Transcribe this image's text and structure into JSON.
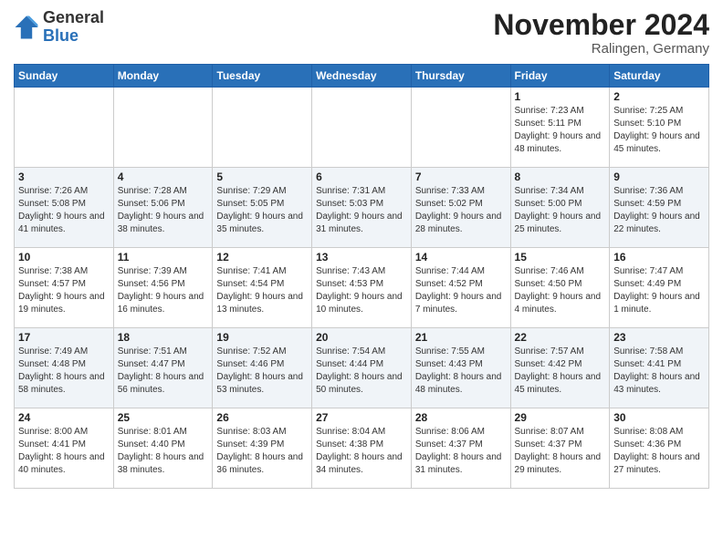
{
  "logo": {
    "general": "General",
    "blue": "Blue"
  },
  "title": "November 2024",
  "location": "Ralingen, Germany",
  "days_of_week": [
    "Sunday",
    "Monday",
    "Tuesday",
    "Wednesday",
    "Thursday",
    "Friday",
    "Saturday"
  ],
  "weeks": [
    [
      {
        "day": "",
        "info": ""
      },
      {
        "day": "",
        "info": ""
      },
      {
        "day": "",
        "info": ""
      },
      {
        "day": "",
        "info": ""
      },
      {
        "day": "",
        "info": ""
      },
      {
        "day": "1",
        "info": "Sunrise: 7:23 AM\nSunset: 5:11 PM\nDaylight: 9 hours and 48 minutes."
      },
      {
        "day": "2",
        "info": "Sunrise: 7:25 AM\nSunset: 5:10 PM\nDaylight: 9 hours and 45 minutes."
      }
    ],
    [
      {
        "day": "3",
        "info": "Sunrise: 7:26 AM\nSunset: 5:08 PM\nDaylight: 9 hours and 41 minutes."
      },
      {
        "day": "4",
        "info": "Sunrise: 7:28 AM\nSunset: 5:06 PM\nDaylight: 9 hours and 38 minutes."
      },
      {
        "day": "5",
        "info": "Sunrise: 7:29 AM\nSunset: 5:05 PM\nDaylight: 9 hours and 35 minutes."
      },
      {
        "day": "6",
        "info": "Sunrise: 7:31 AM\nSunset: 5:03 PM\nDaylight: 9 hours and 31 minutes."
      },
      {
        "day": "7",
        "info": "Sunrise: 7:33 AM\nSunset: 5:02 PM\nDaylight: 9 hours and 28 minutes."
      },
      {
        "day": "8",
        "info": "Sunrise: 7:34 AM\nSunset: 5:00 PM\nDaylight: 9 hours and 25 minutes."
      },
      {
        "day": "9",
        "info": "Sunrise: 7:36 AM\nSunset: 4:59 PM\nDaylight: 9 hours and 22 minutes."
      }
    ],
    [
      {
        "day": "10",
        "info": "Sunrise: 7:38 AM\nSunset: 4:57 PM\nDaylight: 9 hours and 19 minutes."
      },
      {
        "day": "11",
        "info": "Sunrise: 7:39 AM\nSunset: 4:56 PM\nDaylight: 9 hours and 16 minutes."
      },
      {
        "day": "12",
        "info": "Sunrise: 7:41 AM\nSunset: 4:54 PM\nDaylight: 9 hours and 13 minutes."
      },
      {
        "day": "13",
        "info": "Sunrise: 7:43 AM\nSunset: 4:53 PM\nDaylight: 9 hours and 10 minutes."
      },
      {
        "day": "14",
        "info": "Sunrise: 7:44 AM\nSunset: 4:52 PM\nDaylight: 9 hours and 7 minutes."
      },
      {
        "day": "15",
        "info": "Sunrise: 7:46 AM\nSunset: 4:50 PM\nDaylight: 9 hours and 4 minutes."
      },
      {
        "day": "16",
        "info": "Sunrise: 7:47 AM\nSunset: 4:49 PM\nDaylight: 9 hours and 1 minute."
      }
    ],
    [
      {
        "day": "17",
        "info": "Sunrise: 7:49 AM\nSunset: 4:48 PM\nDaylight: 8 hours and 58 minutes."
      },
      {
        "day": "18",
        "info": "Sunrise: 7:51 AM\nSunset: 4:47 PM\nDaylight: 8 hours and 56 minutes."
      },
      {
        "day": "19",
        "info": "Sunrise: 7:52 AM\nSunset: 4:46 PM\nDaylight: 8 hours and 53 minutes."
      },
      {
        "day": "20",
        "info": "Sunrise: 7:54 AM\nSunset: 4:44 PM\nDaylight: 8 hours and 50 minutes."
      },
      {
        "day": "21",
        "info": "Sunrise: 7:55 AM\nSunset: 4:43 PM\nDaylight: 8 hours and 48 minutes."
      },
      {
        "day": "22",
        "info": "Sunrise: 7:57 AM\nSunset: 4:42 PM\nDaylight: 8 hours and 45 minutes."
      },
      {
        "day": "23",
        "info": "Sunrise: 7:58 AM\nSunset: 4:41 PM\nDaylight: 8 hours and 43 minutes."
      }
    ],
    [
      {
        "day": "24",
        "info": "Sunrise: 8:00 AM\nSunset: 4:41 PM\nDaylight: 8 hours and 40 minutes."
      },
      {
        "day": "25",
        "info": "Sunrise: 8:01 AM\nSunset: 4:40 PM\nDaylight: 8 hours and 38 minutes."
      },
      {
        "day": "26",
        "info": "Sunrise: 8:03 AM\nSunset: 4:39 PM\nDaylight: 8 hours and 36 minutes."
      },
      {
        "day": "27",
        "info": "Sunrise: 8:04 AM\nSunset: 4:38 PM\nDaylight: 8 hours and 34 minutes."
      },
      {
        "day": "28",
        "info": "Sunrise: 8:06 AM\nSunset: 4:37 PM\nDaylight: 8 hours and 31 minutes."
      },
      {
        "day": "29",
        "info": "Sunrise: 8:07 AM\nSunset: 4:37 PM\nDaylight: 8 hours and 29 minutes."
      },
      {
        "day": "30",
        "info": "Sunrise: 8:08 AM\nSunset: 4:36 PM\nDaylight: 8 hours and 27 minutes."
      }
    ]
  ]
}
